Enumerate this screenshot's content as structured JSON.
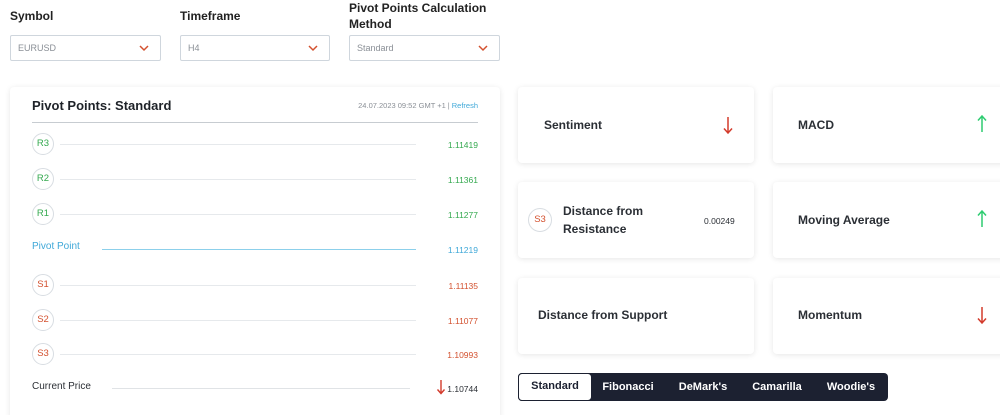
{
  "filters": {
    "symbol": {
      "label": "Symbol",
      "value": "EURUSD"
    },
    "timeframe": {
      "label": "Timeframe",
      "value": "H4"
    },
    "method": {
      "label_line1": "Pivot Points Calculation",
      "label_line2": "Method",
      "value": "Standard"
    }
  },
  "pivot_panel": {
    "title": "Pivot Points: Standard",
    "timestamp": "24.07.2023 09:52 GMT +1",
    "separator": "|",
    "refresh": "Refresh",
    "r3": {
      "badge": "R3",
      "value": "1.11419"
    },
    "r2": {
      "badge": "R2",
      "value": "1.11361"
    },
    "r1": {
      "badge": "R1",
      "value": "1.11277"
    },
    "pivot": {
      "label": "Pivot Point",
      "value": "1.11219"
    },
    "s1": {
      "badge": "S1",
      "value": "1.11135"
    },
    "s2": {
      "badge": "S2",
      "value": "1.11077"
    },
    "s3": {
      "badge": "S3",
      "value": "1.10993"
    },
    "current": {
      "label": "Current Price",
      "value": "1.10744",
      "direction": "down"
    }
  },
  "indicators": {
    "sentiment": {
      "label": "Sentiment",
      "direction": "down"
    },
    "macd": {
      "label": "MACD",
      "direction": "up"
    },
    "distance_resistance": {
      "badge": "S3",
      "label_line1": "Distance from",
      "label_line2": "Resistance",
      "value": "0.00249"
    },
    "moving_average": {
      "label": "Moving Average",
      "direction": "up"
    },
    "distance_support": {
      "label": "Distance from Support"
    },
    "momentum": {
      "label": "Momentum",
      "direction": "down"
    }
  },
  "tabs": {
    "standard": "Standard",
    "fibonacci": "Fibonacci",
    "demark": "DeMark's",
    "camarilla": "Camarilla",
    "woodie": "Woodie's",
    "active": "Standard"
  },
  "colors": {
    "up": "#2ecc71",
    "down": "#d33b2c",
    "resistance": "#34a94f",
    "support": "#d3512f",
    "pivot": "#3fa8d8",
    "tabs_bg": "#1c2131"
  },
  "icons": {
    "dropdown": "chevron-down-icon",
    "up": "arrow-up-icon",
    "down": "arrow-down-icon"
  }
}
